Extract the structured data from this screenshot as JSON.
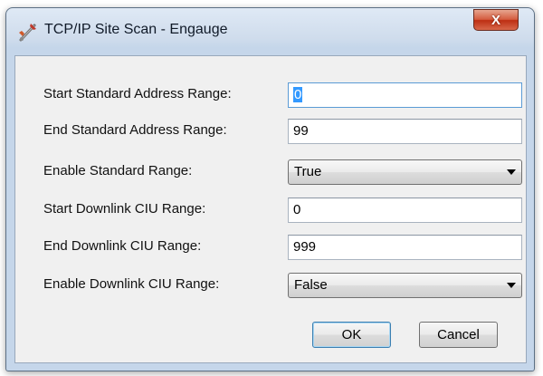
{
  "window": {
    "title": "TCP/IP Site Scan - Engauge",
    "close_symbol": "X",
    "icon": "network-tool-icon"
  },
  "fields": {
    "start_standard": {
      "label": "Start Standard Address Range:",
      "value": "0"
    },
    "end_standard": {
      "label": "End Standard Address Range:",
      "value": "99"
    },
    "enable_standard": {
      "label": "Enable Standard Range:",
      "value": "True"
    },
    "start_downlink": {
      "label": "Start Downlink CIU Range:",
      "value": "0"
    },
    "end_downlink": {
      "label": "End Downlink CIU Range:",
      "value": "999"
    },
    "enable_downlink": {
      "label": "Enable Downlink CIU Range:",
      "value": "False"
    }
  },
  "buttons": {
    "ok": "OK",
    "cancel": "Cancel"
  },
  "colors": {
    "close_button": "#c7391c",
    "focus_border": "#5b9bd5",
    "selection": "#3399ff"
  }
}
